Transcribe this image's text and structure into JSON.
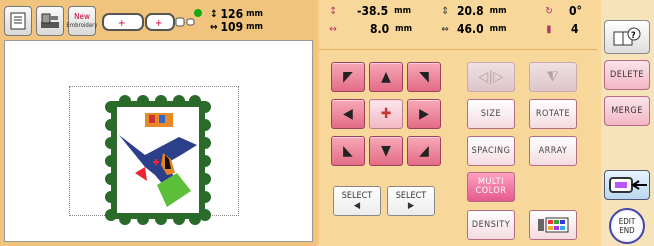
{
  "toolbar": {
    "new_line1": "New",
    "new_line2": "Embroidery",
    "width_value": "126",
    "width_unit": "mm",
    "height_value": "109",
    "height_unit": "mm"
  },
  "info": {
    "x_pos": "-38.5",
    "x_pos_unit": "mm",
    "y_pos": "8.0",
    "y_pos_unit": "mm",
    "width": "20.8",
    "width_unit": "mm",
    "height": "46.0",
    "height_unit": "mm",
    "rotation": "0°",
    "thread_count": "4"
  },
  "buttons": {
    "size": "SIZE",
    "rotate": "ROTATE",
    "spacing": "SPACING",
    "array": "ARRAY",
    "multi_color_line1": "MULTI",
    "multi_color_line2": "COLOR",
    "density": "DENSITY",
    "select_prev_label": "SELECT",
    "select_next_label": "SELECT",
    "delete": "DELETE",
    "merge": "MERGE",
    "edit_end_line1": "EDIT",
    "edit_end_line2": "END"
  },
  "colors": {
    "pink_button": "#e36c86",
    "panel_bg": "#f8d89a",
    "stamp_border": "#1f5a1f"
  }
}
